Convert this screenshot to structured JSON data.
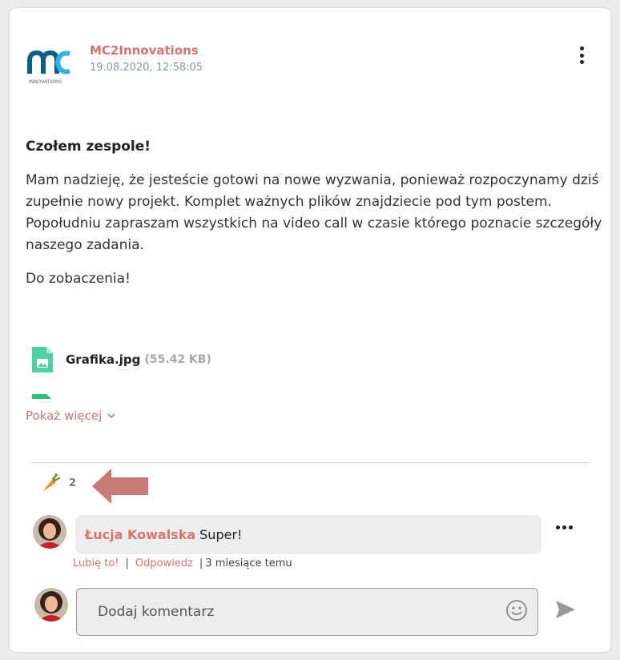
{
  "post": {
    "author": "MC2Innovations",
    "date": "19.08.2020, 12:58:05",
    "logo_caption": "INNOVATIONS",
    "greeting": "Czołem zespole!",
    "paragraph": "Mam nadzieję, że jesteście gotowi na nowe wyzwania, ponieważ rozpoczynamy dziś zupełnie nowy projekt. Komplet ważnych plików znajdziecie pod tym postem. Popołudniu zapraszam wszystkich na video call w czasie którego poznacie szczegóły naszego zadania.",
    "closing": "Do zobaczenia!"
  },
  "attachments": [
    {
      "name": "Grafika.jpg",
      "size": "(55.42 KB)"
    }
  ],
  "show_more_label": "Pokaż więcej",
  "reactions": {
    "icon": "carrot-icon",
    "count": "2"
  },
  "comment": {
    "author": "Łucja Kowalska",
    "text": "Super!",
    "like_label": "Lubię to!",
    "reply_label": "Odpowiedz",
    "time": "3 miesiące temu"
  },
  "composer": {
    "placeholder": "Dodaj komentarz"
  },
  "colors": {
    "accent": "#d4766f",
    "file_icon": "#4fcfa4",
    "annotation_arrow": "#c97a77"
  }
}
